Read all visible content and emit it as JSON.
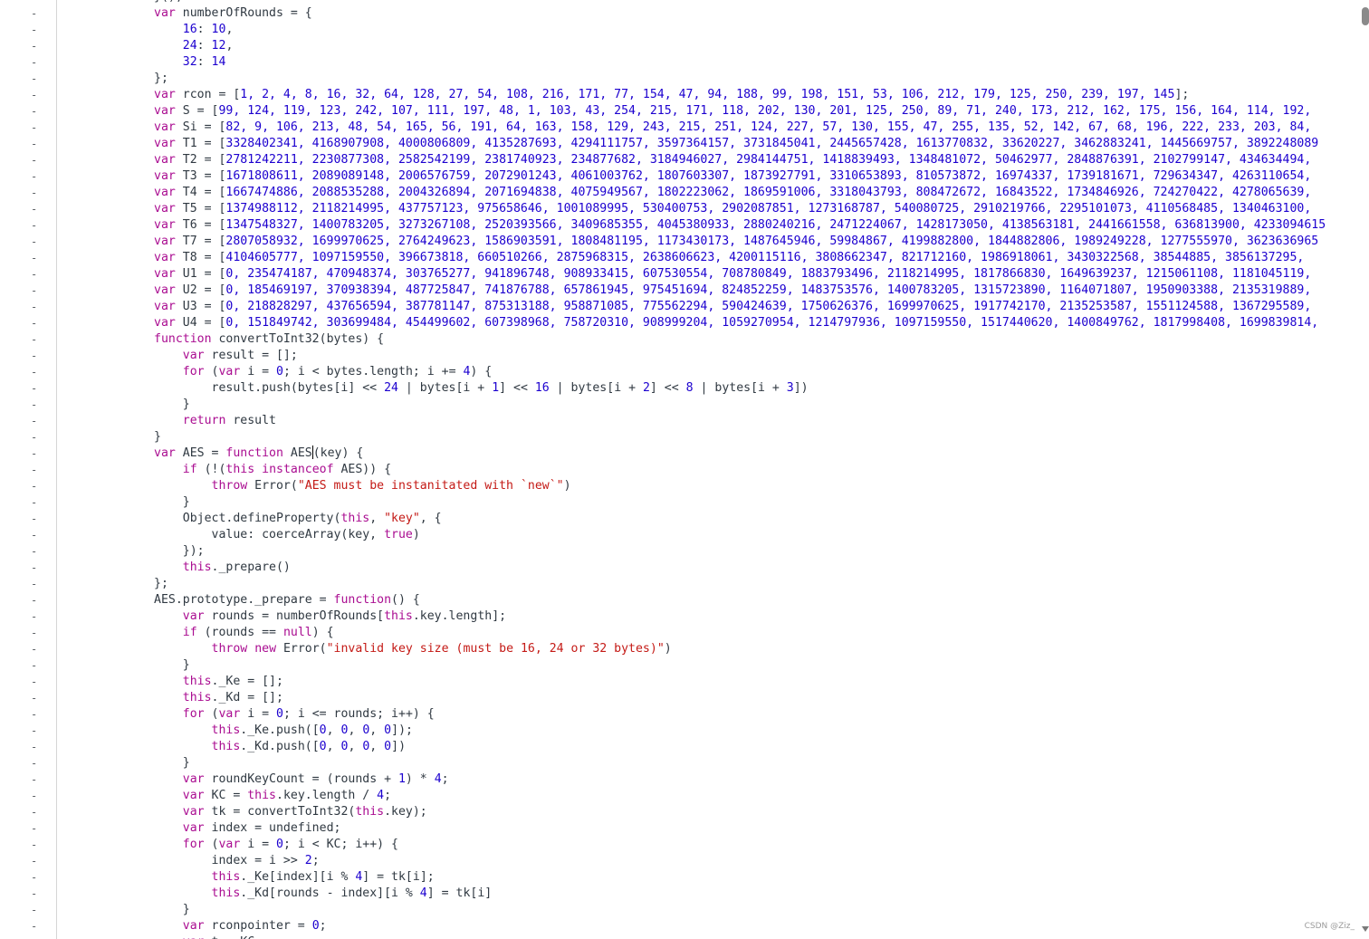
{
  "gutter": {
    "marker": "-"
  },
  "watermark": "CSDN @Ziz_",
  "code_lines": [
    [
      [
        "p",
        "}();"
      ]
    ],
    [
      [
        "kw",
        "var"
      ],
      [
        "p",
        " numberOfRounds = {"
      ]
    ],
    [
      [
        "p",
        "    "
      ],
      [
        "num",
        "16"
      ],
      [
        "p",
        ": "
      ],
      [
        "num",
        "10"
      ],
      [
        "p",
        ","
      ]
    ],
    [
      [
        "p",
        "    "
      ],
      [
        "num",
        "24"
      ],
      [
        "p",
        ": "
      ],
      [
        "num",
        "12"
      ],
      [
        "p",
        ","
      ]
    ],
    [
      [
        "p",
        "    "
      ],
      [
        "num",
        "32"
      ],
      [
        "p",
        ": "
      ],
      [
        "num",
        "14"
      ]
    ],
    [
      [
        "p",
        "};"
      ]
    ],
    [
      [
        "kw",
        "var"
      ],
      [
        "p",
        " rcon = ["
      ],
      [
        "num",
        "1, 2, 4, 8, 16, 32, 64, 128, 27, 54, 108, 216, 171, 77, 154, 47, 94, 188, 99, 198, 151, 53, 106, 212, 179, 125, 250, 239, 197, 145"
      ],
      [
        "p",
        "];"
      ]
    ],
    [
      [
        "kw",
        "var"
      ],
      [
        "p",
        " S = ["
      ],
      [
        "num",
        "99, 124, 119, 123, 242, 107, 111, 197, 48, 1, 103, 43, 254, 215, 171, 118, 202, 130, 201, 125, 250, 89, 71, 240, 173, 212, 162, 175, 156, 164, 114, 192,"
      ]
    ],
    [
      [
        "kw",
        "var"
      ],
      [
        "p",
        " Si = ["
      ],
      [
        "num",
        "82, 9, 106, 213, 48, 54, 165, 56, 191, 64, 163, 158, 129, 243, 215, 251, 124, 227, 57, 130, 155, 47, 255, 135, 52, 142, 67, 68, 196, 222, 233, 203, 84,"
      ]
    ],
    [
      [
        "kw",
        "var"
      ],
      [
        "p",
        " T1 = ["
      ],
      [
        "num",
        "3328402341, 4168907908, 4000806809, 4135287693, 4294111757, 3597364157, 3731845041, 2445657428, 1613770832, 33620227, 3462883241, 1445669757, 3892248089"
      ]
    ],
    [
      [
        "kw",
        "var"
      ],
      [
        "p",
        " T2 = ["
      ],
      [
        "num",
        "2781242211, 2230877308, 2582542199, 2381740923, 234877682, 3184946027, 2984144751, 1418839493, 1348481072, 50462977, 2848876391, 2102799147, 434634494,"
      ]
    ],
    [
      [
        "kw",
        "var"
      ],
      [
        "p",
        " T3 = ["
      ],
      [
        "num",
        "1671808611, 2089089148, 2006576759, 2072901243, 4061003762, 1807603307, 1873927791, 3310653893, 810573872, 16974337, 1739181671, 729634347, 4263110654,"
      ]
    ],
    [
      [
        "kw",
        "var"
      ],
      [
        "p",
        " T4 = ["
      ],
      [
        "num",
        "1667474886, 2088535288, 2004326894, 2071694838, 4075949567, 1802223062, 1869591006, 3318043793, 808472672, 16843522, 1734846926, 724270422, 4278065639,"
      ]
    ],
    [
      [
        "kw",
        "var"
      ],
      [
        "p",
        " T5 = ["
      ],
      [
        "num",
        "1374988112, 2118214995, 437757123, 975658646, 1001089995, 530400753, 2902087851, 1273168787, 540080725, 2910219766, 2295101073, 4110568485, 1340463100,"
      ]
    ],
    [
      [
        "kw",
        "var"
      ],
      [
        "p",
        " T6 = ["
      ],
      [
        "num",
        "1347548327, 1400783205, 3273267108, 2520393566, 3409685355, 4045380933, 2880240216, 2471224067, 1428173050, 4138563181, 2441661558, 636813900, 4233094615"
      ]
    ],
    [
      [
        "kw",
        "var"
      ],
      [
        "p",
        " T7 = ["
      ],
      [
        "num",
        "2807058932, 1699970625, 2764249623, 1586903591, 1808481195, 1173430173, 1487645946, 59984867, 4199882800, 1844882806, 1989249228, 1277555970, 3623636965"
      ]
    ],
    [
      [
        "kw",
        "var"
      ],
      [
        "p",
        " T8 = ["
      ],
      [
        "num",
        "4104605777, 1097159550, 396673818, 660510266, 2875968315, 2638606623, 4200115116, 3808662347, 821712160, 1986918061, 3430322568, 38544885, 3856137295,"
      ]
    ],
    [
      [
        "kw",
        "var"
      ],
      [
        "p",
        " U1 = ["
      ],
      [
        "num",
        "0, 235474187, 470948374, 303765277, 941896748, 908933415, 607530554, 708780849, 1883793496, 2118214995, 1817866830, 1649639237, 1215061108, 1181045119,"
      ]
    ],
    [
      [
        "kw",
        "var"
      ],
      [
        "p",
        " U2 = ["
      ],
      [
        "num",
        "0, 185469197, 370938394, 487725847, 741876788, 657861945, 975451694, 824852259, 1483753576, 1400783205, 1315723890, 1164071807, 1950903388, 2135319889,"
      ]
    ],
    [
      [
        "kw",
        "var"
      ],
      [
        "p",
        " U3 = ["
      ],
      [
        "num",
        "0, 218828297, 437656594, 387781147, 875313188, 958871085, 775562294, 590424639, 1750626376, 1699970625, 1917742170, 2135253587, 1551124588, 1367295589,"
      ]
    ],
    [
      [
        "kw",
        "var"
      ],
      [
        "p",
        " U4 = ["
      ],
      [
        "num",
        "0, 151849742, 303699484, 454499602, 607398968, 758720310, 908999204, 1059270954, 1214797936, 1097159550, 1517440620, 1400849762, 1817998408, 1699839814,"
      ]
    ],
    [
      [
        "kw",
        "function"
      ],
      [
        "p",
        " convertToInt32(bytes) {"
      ]
    ],
    [
      [
        "p",
        "    "
      ],
      [
        "kw",
        "var"
      ],
      [
        "p",
        " result = [];"
      ]
    ],
    [
      [
        "p",
        "    "
      ],
      [
        "kw",
        "for"
      ],
      [
        "p",
        " ("
      ],
      [
        "kw",
        "var"
      ],
      [
        "p",
        " i = "
      ],
      [
        "num",
        "0"
      ],
      [
        "p",
        "; i < bytes.length; i += "
      ],
      [
        "num",
        "4"
      ],
      [
        "p",
        ") {"
      ]
    ],
    [
      [
        "p",
        "        result.push(bytes[i] << "
      ],
      [
        "num",
        "24"
      ],
      [
        "p",
        " | bytes[i + "
      ],
      [
        "num",
        "1"
      ],
      [
        "p",
        "] << "
      ],
      [
        "num",
        "16"
      ],
      [
        "p",
        " | bytes[i + "
      ],
      [
        "num",
        "2"
      ],
      [
        "p",
        "] << "
      ],
      [
        "num",
        "8"
      ],
      [
        "p",
        " | bytes[i + "
      ],
      [
        "num",
        "3"
      ],
      [
        "p",
        "])"
      ]
    ],
    [
      [
        "p",
        "    }"
      ]
    ],
    [
      [
        "p",
        "    "
      ],
      [
        "kw",
        "return"
      ],
      [
        "p",
        " result"
      ]
    ],
    [
      [
        "p",
        "}"
      ]
    ],
    [
      [
        "kw",
        "var"
      ],
      [
        "p",
        " AES = "
      ],
      [
        "kw",
        "function"
      ],
      [
        "p",
        " AES"
      ],
      [
        "cursor",
        ""
      ],
      [
        "p",
        "(key) {"
      ]
    ],
    [
      [
        "p",
        "    "
      ],
      [
        "kw",
        "if"
      ],
      [
        "p",
        " (!("
      ],
      [
        "kw",
        "this"
      ],
      [
        "p",
        " "
      ],
      [
        "kw",
        "instanceof"
      ],
      [
        "p",
        " AES)) {"
      ]
    ],
    [
      [
        "p",
        "        "
      ],
      [
        "kw",
        "throw"
      ],
      [
        "p",
        " Error("
      ],
      [
        "str",
        "\"AES must be instanitated with `new`\""
      ],
      [
        "p",
        ")"
      ]
    ],
    [
      [
        "p",
        "    }"
      ]
    ],
    [
      [
        "p",
        "    Object.defineProperty("
      ],
      [
        "kw",
        "this"
      ],
      [
        "p",
        ", "
      ],
      [
        "str",
        "\"key\""
      ],
      [
        "p",
        ", {"
      ]
    ],
    [
      [
        "p",
        "        value: coerceArray(key, "
      ],
      [
        "kw",
        "true"
      ],
      [
        "p",
        ")"
      ]
    ],
    [
      [
        "p",
        "    });"
      ]
    ],
    [
      [
        "p",
        "    "
      ],
      [
        "kw",
        "this"
      ],
      [
        "p",
        "._prepare()"
      ]
    ],
    [
      [
        "p",
        "};"
      ]
    ],
    [
      [
        "p",
        "AES.prototype._prepare = "
      ],
      [
        "kw",
        "function"
      ],
      [
        "p",
        "() {"
      ]
    ],
    [
      [
        "p",
        "    "
      ],
      [
        "kw",
        "var"
      ],
      [
        "p",
        " rounds = numberOfRounds["
      ],
      [
        "kw",
        "this"
      ],
      [
        "p",
        ".key.length];"
      ]
    ],
    [
      [
        "p",
        "    "
      ],
      [
        "kw",
        "if"
      ],
      [
        "p",
        " (rounds == "
      ],
      [
        "kw",
        "null"
      ],
      [
        "p",
        ") {"
      ]
    ],
    [
      [
        "p",
        "        "
      ],
      [
        "kw",
        "throw"
      ],
      [
        "p",
        " "
      ],
      [
        "kw",
        "new"
      ],
      [
        "p",
        " Error("
      ],
      [
        "str",
        "\"invalid key size (must be 16, 24 or 32 bytes)\""
      ],
      [
        "p",
        ")"
      ]
    ],
    [
      [
        "p",
        "    }"
      ]
    ],
    [
      [
        "p",
        "    "
      ],
      [
        "kw",
        "this"
      ],
      [
        "p",
        "._Ke = [];"
      ]
    ],
    [
      [
        "p",
        "    "
      ],
      [
        "kw",
        "this"
      ],
      [
        "p",
        "._Kd = [];"
      ]
    ],
    [
      [
        "p",
        "    "
      ],
      [
        "kw",
        "for"
      ],
      [
        "p",
        " ("
      ],
      [
        "kw",
        "var"
      ],
      [
        "p",
        " i = "
      ],
      [
        "num",
        "0"
      ],
      [
        "p",
        "; i <= rounds; i++) {"
      ]
    ],
    [
      [
        "p",
        "        "
      ],
      [
        "kw",
        "this"
      ],
      [
        "p",
        "._Ke.push(["
      ],
      [
        "num",
        "0"
      ],
      [
        "p",
        ", "
      ],
      [
        "num",
        "0"
      ],
      [
        "p",
        ", "
      ],
      [
        "num",
        "0"
      ],
      [
        "p",
        ", "
      ],
      [
        "num",
        "0"
      ],
      [
        "p",
        "]);"
      ]
    ],
    [
      [
        "p",
        "        "
      ],
      [
        "kw",
        "this"
      ],
      [
        "p",
        "._Kd.push(["
      ],
      [
        "num",
        "0"
      ],
      [
        "p",
        ", "
      ],
      [
        "num",
        "0"
      ],
      [
        "p",
        ", "
      ],
      [
        "num",
        "0"
      ],
      [
        "p",
        ", "
      ],
      [
        "num",
        "0"
      ],
      [
        "p",
        "])"
      ]
    ],
    [
      [
        "p",
        "    }"
      ]
    ],
    [
      [
        "p",
        "    "
      ],
      [
        "kw",
        "var"
      ],
      [
        "p",
        " roundKeyCount = (rounds + "
      ],
      [
        "num",
        "1"
      ],
      [
        "p",
        ") * "
      ],
      [
        "num",
        "4"
      ],
      [
        "p",
        ";"
      ]
    ],
    [
      [
        "p",
        "    "
      ],
      [
        "kw",
        "var"
      ],
      [
        "p",
        " KC = "
      ],
      [
        "kw",
        "this"
      ],
      [
        "p",
        ".key.length / "
      ],
      [
        "num",
        "4"
      ],
      [
        "p",
        ";"
      ]
    ],
    [
      [
        "p",
        "    "
      ],
      [
        "kw",
        "var"
      ],
      [
        "p",
        " tk = convertToInt32("
      ],
      [
        "kw",
        "this"
      ],
      [
        "p",
        ".key);"
      ]
    ],
    [
      [
        "p",
        "    "
      ],
      [
        "kw",
        "var"
      ],
      [
        "p",
        " index = undefined;"
      ]
    ],
    [
      [
        "p",
        "    "
      ],
      [
        "kw",
        "for"
      ],
      [
        "p",
        " ("
      ],
      [
        "kw",
        "var"
      ],
      [
        "p",
        " i = "
      ],
      [
        "num",
        "0"
      ],
      [
        "p",
        "; i < KC; i++) {"
      ]
    ],
    [
      [
        "p",
        "        index = i >> "
      ],
      [
        "num",
        "2"
      ],
      [
        "p",
        ";"
      ]
    ],
    [
      [
        "p",
        "        "
      ],
      [
        "kw",
        "this"
      ],
      [
        "p",
        "._Ke[index][i % "
      ],
      [
        "num",
        "4"
      ],
      [
        "p",
        "] = tk[i];"
      ]
    ],
    [
      [
        "p",
        "        "
      ],
      [
        "kw",
        "this"
      ],
      [
        "p",
        "._Kd[rounds - index][i % "
      ],
      [
        "num",
        "4"
      ],
      [
        "p",
        "] = tk[i]"
      ]
    ],
    [
      [
        "p",
        "    }"
      ]
    ],
    [
      [
        "p",
        "    "
      ],
      [
        "kw",
        "var"
      ],
      [
        "p",
        " rconpointer = "
      ],
      [
        "num",
        "0"
      ],
      [
        "p",
        ";"
      ]
    ],
    [
      [
        "p",
        "    "
      ],
      [
        "kw",
        "var"
      ],
      [
        "p",
        " t = KC"
      ]
    ]
  ]
}
